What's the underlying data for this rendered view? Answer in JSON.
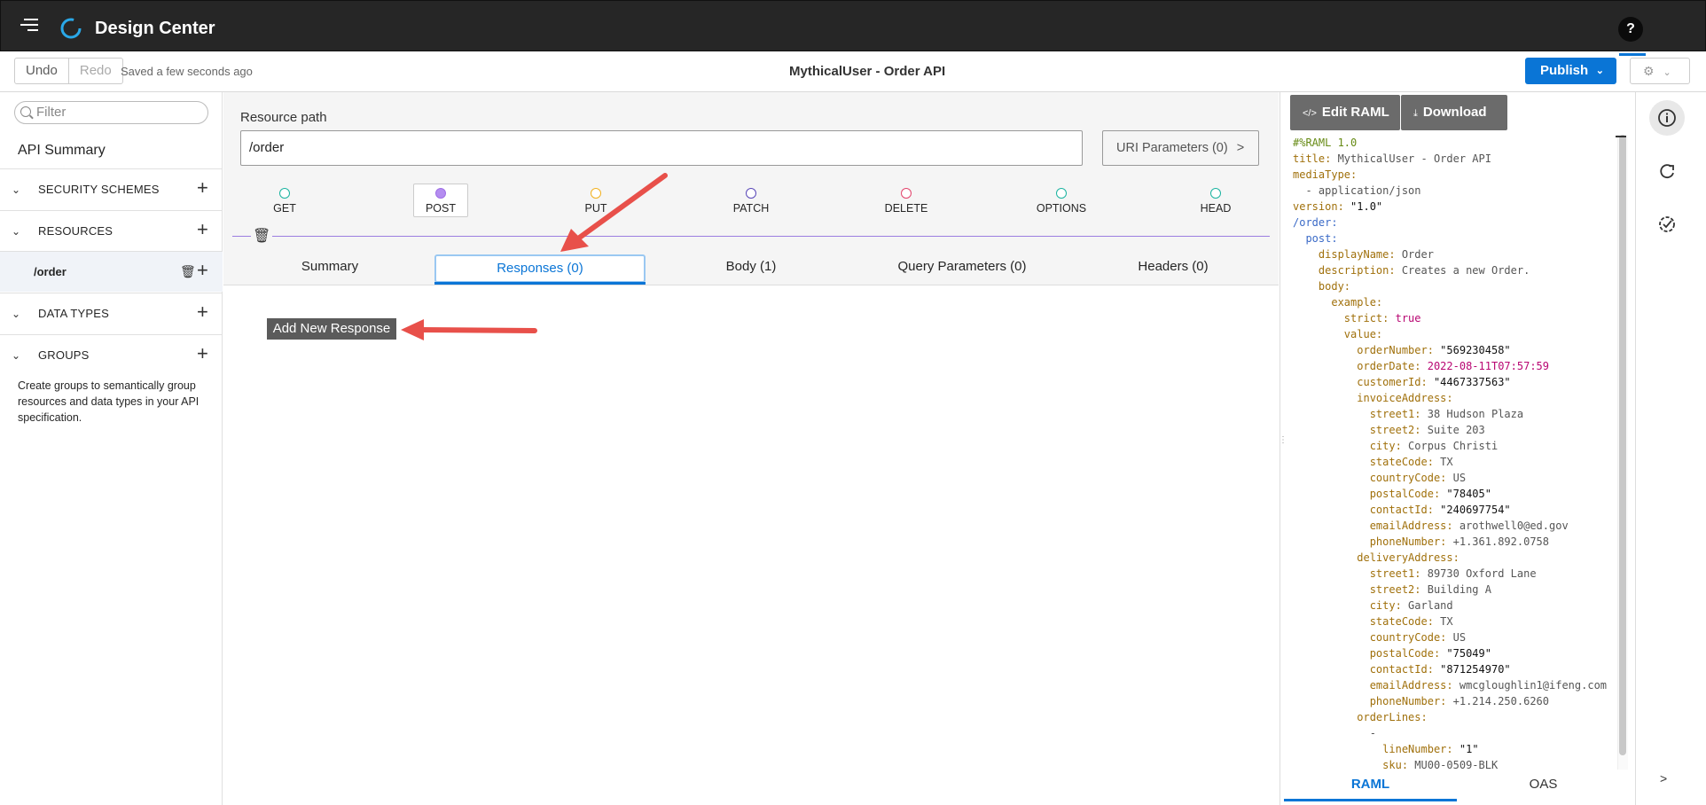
{
  "header": {
    "app_title": "Design Center",
    "help_label": "?"
  },
  "toolbar": {
    "undo_label": "Undo",
    "redo_label": "Redo",
    "saved_status": "Saved a few seconds ago",
    "doc_title": "MythicalUser - Order API",
    "publish_label": "Publish"
  },
  "sidebar": {
    "filter_placeholder": "Filter",
    "api_summary": "API Summary",
    "sections": [
      {
        "label": "SECURITY SCHEMES"
      },
      {
        "label": "RESOURCES"
      },
      {
        "label": "DATA TYPES"
      },
      {
        "label": "GROUPS"
      }
    ],
    "resource_item": "/order",
    "groups_help": "Create groups to semantically group resources and data types in your API specification."
  },
  "main": {
    "resource_path_label": "Resource path",
    "resource_path_value": "/order",
    "uri_parameters_label": "URI Parameters (0)",
    "methods": [
      {
        "label": "GET",
        "color": "#1bb3a0",
        "active": false
      },
      {
        "label": "POST",
        "color": "#9f6ee6",
        "active": true
      },
      {
        "label": "PUT",
        "color": "#f2b11f",
        "active": false
      },
      {
        "label": "PATCH",
        "color": "#5a48b8",
        "active": false
      },
      {
        "label": "DELETE",
        "color": "#e2436b",
        "active": false
      },
      {
        "label": "OPTIONS",
        "color": "#1bb3a0",
        "active": false
      },
      {
        "label": "HEAD",
        "color": "#1bb3a0",
        "active": false
      }
    ],
    "tabs": [
      {
        "label": "Summary"
      },
      {
        "label": "Responses (0)"
      },
      {
        "label": "Body (1)"
      },
      {
        "label": "Query Parameters (0)"
      },
      {
        "label": "Headers (0)"
      }
    ],
    "add_response_label": "Add New Response"
  },
  "raml_panel": {
    "edit_raml_label": "Edit RAML",
    "download_label": "Download",
    "bottom_tabs": [
      {
        "label": "RAML"
      },
      {
        "label": "OAS"
      }
    ]
  },
  "code_lines": [
    {
      "indent": 0,
      "key": "#%RAML 1.0",
      "val": "",
      "kc": "cm",
      "vc": "v"
    },
    {
      "indent": 0,
      "key": "title:",
      "val": " MythicalUser - Order API",
      "kc": "k",
      "vc": "v"
    },
    {
      "indent": 0,
      "key": "mediaType:",
      "val": "",
      "kc": "k",
      "vc": "v"
    },
    {
      "indent": 1,
      "key": "- ",
      "val": "application/json",
      "kc": "v",
      "vc": "v"
    },
    {
      "indent": 0,
      "key": "version:",
      "val": " \"1.0\"",
      "kc": "k",
      "vc": "s"
    },
    {
      "indent": 0,
      "key": "/order:",
      "val": "",
      "kc": "p",
      "vc": "v"
    },
    {
      "indent": 1,
      "key": "post:",
      "val": "",
      "kc": "p",
      "vc": "v"
    },
    {
      "indent": 2,
      "key": "displayName:",
      "val": " Order",
      "kc": "k",
      "vc": "v"
    },
    {
      "indent": 2,
      "key": "description:",
      "val": " Creates a new Order.",
      "kc": "k",
      "vc": "v"
    },
    {
      "indent": 2,
      "key": "body:",
      "val": "",
      "kc": "k",
      "vc": "v"
    },
    {
      "indent": 3,
      "key": "example:",
      "val": "",
      "kc": "k",
      "vc": "v"
    },
    {
      "indent": 4,
      "key": "strict:",
      "val": " true",
      "kc": "k",
      "vc": "m"
    },
    {
      "indent": 4,
      "key": "value:",
      "val": "",
      "kc": "k",
      "vc": "v"
    },
    {
      "indent": 5,
      "key": "orderNumber:",
      "val": " \"569230458\"",
      "kc": "k",
      "vc": "s"
    },
    {
      "indent": 5,
      "key": "orderDate:",
      "val": " 2022-08-11T07:57:59",
      "kc": "k",
      "vc": "m"
    },
    {
      "indent": 5,
      "key": "customerId:",
      "val": " \"4467337563\"",
      "kc": "k",
      "vc": "s"
    },
    {
      "indent": 5,
      "key": "invoiceAddress:",
      "val": "",
      "kc": "k",
      "vc": "v"
    },
    {
      "indent": 6,
      "key": "street1:",
      "val": " 38 Hudson Plaza",
      "kc": "k",
      "vc": "v"
    },
    {
      "indent": 6,
      "key": "street2:",
      "val": " Suite 203",
      "kc": "k",
      "vc": "v"
    },
    {
      "indent": 6,
      "key": "city:",
      "val": " Corpus Christi",
      "kc": "k",
      "vc": "v"
    },
    {
      "indent": 6,
      "key": "stateCode:",
      "val": " TX",
      "kc": "k",
      "vc": "v"
    },
    {
      "indent": 6,
      "key": "countryCode:",
      "val": " US",
      "kc": "k",
      "vc": "v"
    },
    {
      "indent": 6,
      "key": "postalCode:",
      "val": " \"78405\"",
      "kc": "k",
      "vc": "s"
    },
    {
      "indent": 6,
      "key": "contactId:",
      "val": " \"240697754\"",
      "kc": "k",
      "vc": "s"
    },
    {
      "indent": 6,
      "key": "emailAddress:",
      "val": " arothwell0@ed.gov",
      "kc": "k",
      "vc": "v"
    },
    {
      "indent": 6,
      "key": "phoneNumber:",
      "val": " +1.361.892.0758",
      "kc": "k",
      "vc": "v"
    },
    {
      "indent": 5,
      "key": "deliveryAddress:",
      "val": "",
      "kc": "k",
      "vc": "v"
    },
    {
      "indent": 6,
      "key": "street1:",
      "val": " 89730 Oxford Lane",
      "kc": "k",
      "vc": "v"
    },
    {
      "indent": 6,
      "key": "street2:",
      "val": " Building A",
      "kc": "k",
      "vc": "v"
    },
    {
      "indent": 6,
      "key": "city:",
      "val": " Garland",
      "kc": "k",
      "vc": "v"
    },
    {
      "indent": 6,
      "key": "stateCode:",
      "val": " TX",
      "kc": "k",
      "vc": "v"
    },
    {
      "indent": 6,
      "key": "countryCode:",
      "val": " US",
      "kc": "k",
      "vc": "v"
    },
    {
      "indent": 6,
      "key": "postalCode:",
      "val": " \"75049\"",
      "kc": "k",
      "vc": "s"
    },
    {
      "indent": 6,
      "key": "contactId:",
      "val": " \"871254970\"",
      "kc": "k",
      "vc": "s"
    },
    {
      "indent": 6,
      "key": "emailAddress:",
      "val": " wmcgloughlin1@ifeng.com",
      "kc": "k",
      "vc": "v"
    },
    {
      "indent": 6,
      "key": "phoneNumber:",
      "val": " +1.214.250.6260",
      "kc": "k",
      "vc": "v"
    },
    {
      "indent": 5,
      "key": "orderLines:",
      "val": "",
      "kc": "k",
      "vc": "v"
    },
    {
      "indent": 6,
      "key": "-",
      "val": "",
      "kc": "v",
      "vc": "v"
    },
    {
      "indent": 7,
      "key": "lineNumber:",
      "val": " \"1\"",
      "kc": "k",
      "vc": "s"
    },
    {
      "indent": 7,
      "key": "sku:",
      "val": " MU00-0509-BLK",
      "kc": "k",
      "vc": "v"
    }
  ],
  "colors": {
    "accent": "#0a75d6",
    "topbar": "#262626",
    "arrow": "#e8504a"
  },
  "icons": {
    "menu": "hamburger-icon",
    "logo": "design-center-logo",
    "settings": "gear-icon",
    "info": "info-icon",
    "share": "share-icon",
    "validate": "validate-icon"
  }
}
